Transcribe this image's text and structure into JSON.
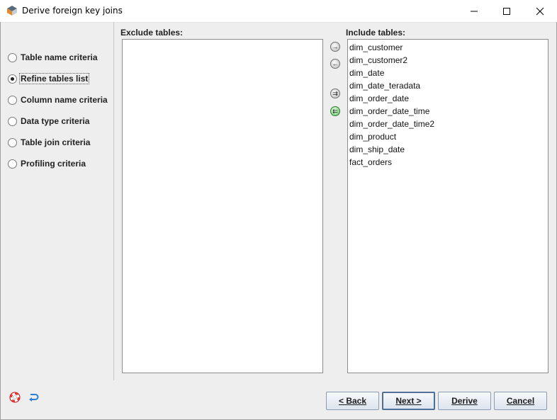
{
  "window": {
    "title": "Derive foreign key joins",
    "icon": "app-logo-icon",
    "controls": [
      "minimize-icon",
      "maximize-icon",
      "close-icon"
    ]
  },
  "sidebar": {
    "items": [
      {
        "label": "Table name criteria",
        "selected": false
      },
      {
        "label": "Refine tables list",
        "selected": true
      },
      {
        "label": "Column name criteria",
        "selected": false
      },
      {
        "label": "Data type criteria",
        "selected": false
      },
      {
        "label": "Table join criteria",
        "selected": false
      },
      {
        "label": "Profiling criteria",
        "selected": false
      }
    ]
  },
  "exclude": {
    "label": "Exclude tables:",
    "items": []
  },
  "include": {
    "label": "Include tables:",
    "items": [
      "dim_customer",
      "dim_customer2",
      "dim_date",
      "dim_date_teradata",
      "dim_order_date",
      "dim_order_date_time",
      "dim_order_date_time2",
      "dim_product",
      "dim_ship_date",
      "fact_orders"
    ]
  },
  "move_buttons": [
    {
      "icon": "arrow-right-icon",
      "glyph": "→"
    },
    {
      "icon": "arrow-left-icon",
      "glyph": "←"
    },
    {
      "icon": "double-arrow-right-icon",
      "glyph": "⇉"
    },
    {
      "icon": "double-arrow-left-icon",
      "glyph": "⇇"
    }
  ],
  "footer": {
    "help_icon": "help-lifebuoy-icon",
    "undo_icon": "undo-arrow-icon",
    "buttons": {
      "back": "< Back",
      "next": "Next >",
      "derive": "Derive",
      "cancel": "Cancel"
    }
  },
  "colors": {
    "background": "#eeeeee",
    "button_border": "#8a9bb3",
    "green_icon": "#5fbd5f"
  }
}
